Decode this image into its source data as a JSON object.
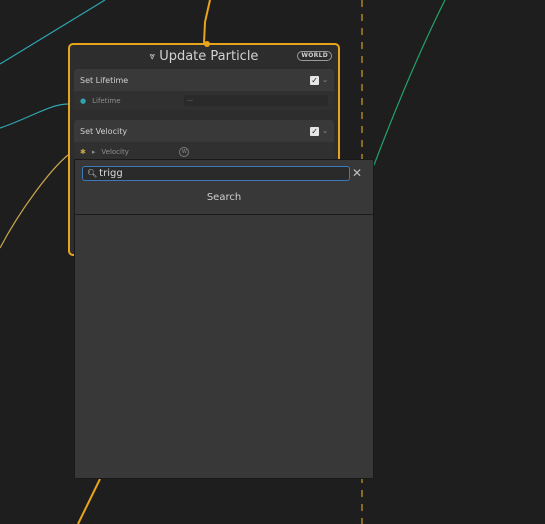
{
  "node": {
    "title": "Update Particle",
    "title_icon": "particle-system-icon",
    "badge": "WORLD",
    "accent_color": "#e8a41c",
    "blocks": [
      {
        "label": "Set Lifetime",
        "enabled": true,
        "property": {
          "label": "Lifetime",
          "value": "—",
          "icon": "float-port-icon"
        }
      },
      {
        "label": "Set Velocity",
        "enabled": true,
        "property": {
          "label": "Velocity",
          "value": "",
          "space_icon": "world-space-icon"
        }
      }
    ]
  },
  "search_popup": {
    "query": "trigg",
    "title": "Search",
    "results": []
  },
  "colors": {
    "background": "#1e1e1e",
    "wire_teal": "#2ea5b0",
    "wire_green": "#22a36a",
    "wire_yellow": "#c9a84b",
    "flow_orange": "#e8a41c",
    "focus_blue": "#3a79bb"
  }
}
